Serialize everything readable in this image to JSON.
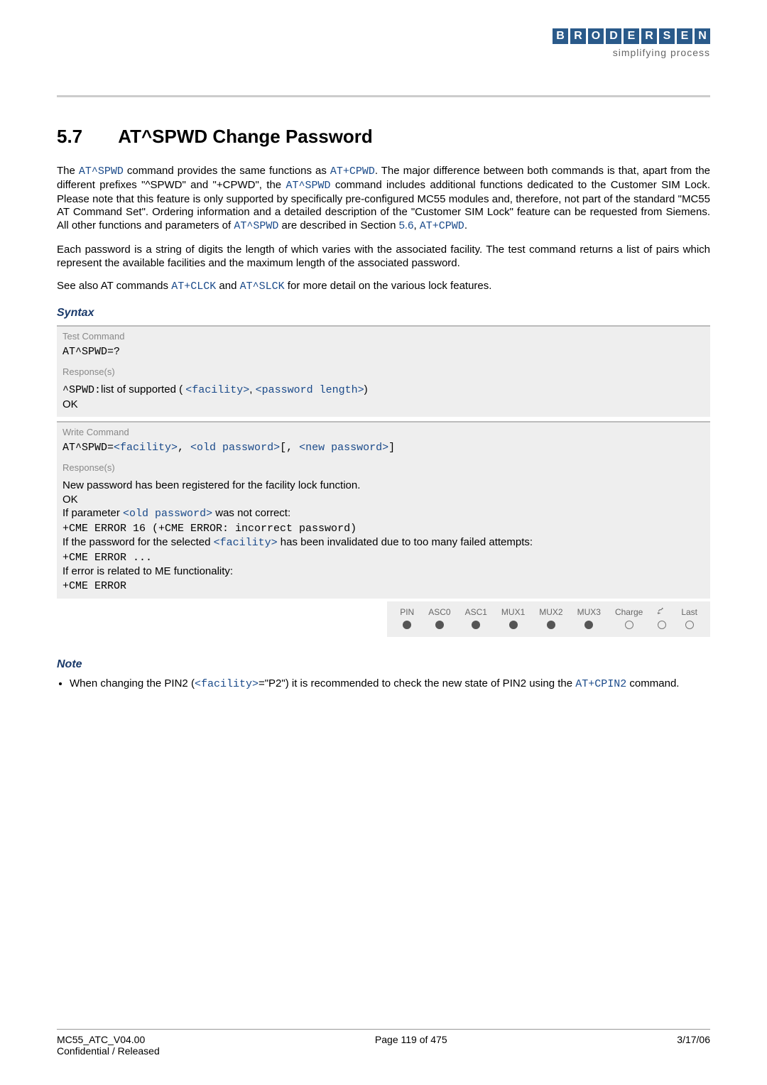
{
  "header": {
    "logo_letters": [
      "B",
      "R",
      "O",
      "D",
      "E",
      "R",
      "S",
      "E",
      "N"
    ],
    "tagline": "simplifying process"
  },
  "section": {
    "number": "5.7",
    "title": "AT^SPWD   Change Password"
  },
  "para1": {
    "t1": "The ",
    "cmd1": "AT^SPWD",
    "t2": " command provides the same functions as ",
    "cmd2": "AT+CPWD",
    "t3": ". The major difference between both commands is that, apart from the different prefixes \"^SPWD\" and \"+CPWD\", the ",
    "cmd3": "AT^SPWD",
    "t4": " command includes additional functions dedicated to the Customer SIM Lock. Please note that this feature is only supported by specifically pre-configured MC55 modules and, therefore, not part of the standard \"MC55 AT Command Set\". Ordering information and a detailed description of the \"Customer SIM Lock\" feature can be requested from Siemens. All other functions and parameters of ",
    "cmd4": "AT^SPWD",
    "t5": " are described in Section ",
    "sec": "5.6",
    "t6": ", ",
    "cmd5": "AT+CPWD",
    "t7": "."
  },
  "para2": "Each password is a string of digits the length of which varies with the associated facility. The test command returns a list of pairs which represent the available facilities and the maximum length of the associated password.",
  "para3": {
    "t1": "See also AT commands ",
    "c1": "AT+CLCK",
    "t2": " and ",
    "c2": "AT^SLCK",
    "t3": " for more detail on the various lock features."
  },
  "syntax_heading": "Syntax",
  "test": {
    "label": "Test Command",
    "cmd": "AT^SPWD=?",
    "resp_label": "Response(s)",
    "resp_prefix": "^SPWD:",
    "resp_text": "list of supported ( ",
    "p1": "<facility>",
    "sep": ", ",
    "p2": "<password length>",
    "close": ")",
    "ok": "OK"
  },
  "write": {
    "label": "Write Command",
    "cmd_prefix": "AT^SPWD=",
    "p1": "<facility>",
    "sep1": ", ",
    "p2": "<old password>",
    "sep2": "[, ",
    "p3": "<new password>",
    "sep3": "]",
    "resp_label": "Response(s)",
    "l1": "New password has been registered for the facility lock function.",
    "l2": "OK",
    "l3a": "If parameter ",
    "l3b": "<old password>",
    "l3c": " was not correct:",
    "l4": "+CME ERROR 16 (+CME ERROR: incorrect password)",
    "l5a": "If the password for the selected ",
    "l5b": "<facility>",
    "l5c": " has been invalidated due to too many failed attempts:",
    "l6": "+CME ERROR ...",
    "l7": "If error is related to ME functionality:",
    "l8": "+CME ERROR"
  },
  "support": {
    "cols": [
      "PIN",
      "ASC0",
      "ASC1",
      "MUX1",
      "MUX2",
      "MUX3",
      "Charge",
      "airtime",
      "Last"
    ],
    "vals": [
      "f",
      "f",
      "f",
      "f",
      "f",
      "f",
      "e",
      "e",
      "e"
    ]
  },
  "note_heading": "Note",
  "note1": {
    "t1": "When changing the PIN2 (",
    "p1": "<facility>",
    "t2": "=\"P2\") it is recommended to check the new state of PIN2 using the ",
    "c1": "AT+CPIN2",
    "t3": " command."
  },
  "footer": {
    "left": "MC55_ATC_V04.00",
    "center": "Page 119 of 475",
    "right": "3/17/06",
    "left2": "Confidential / Released"
  }
}
